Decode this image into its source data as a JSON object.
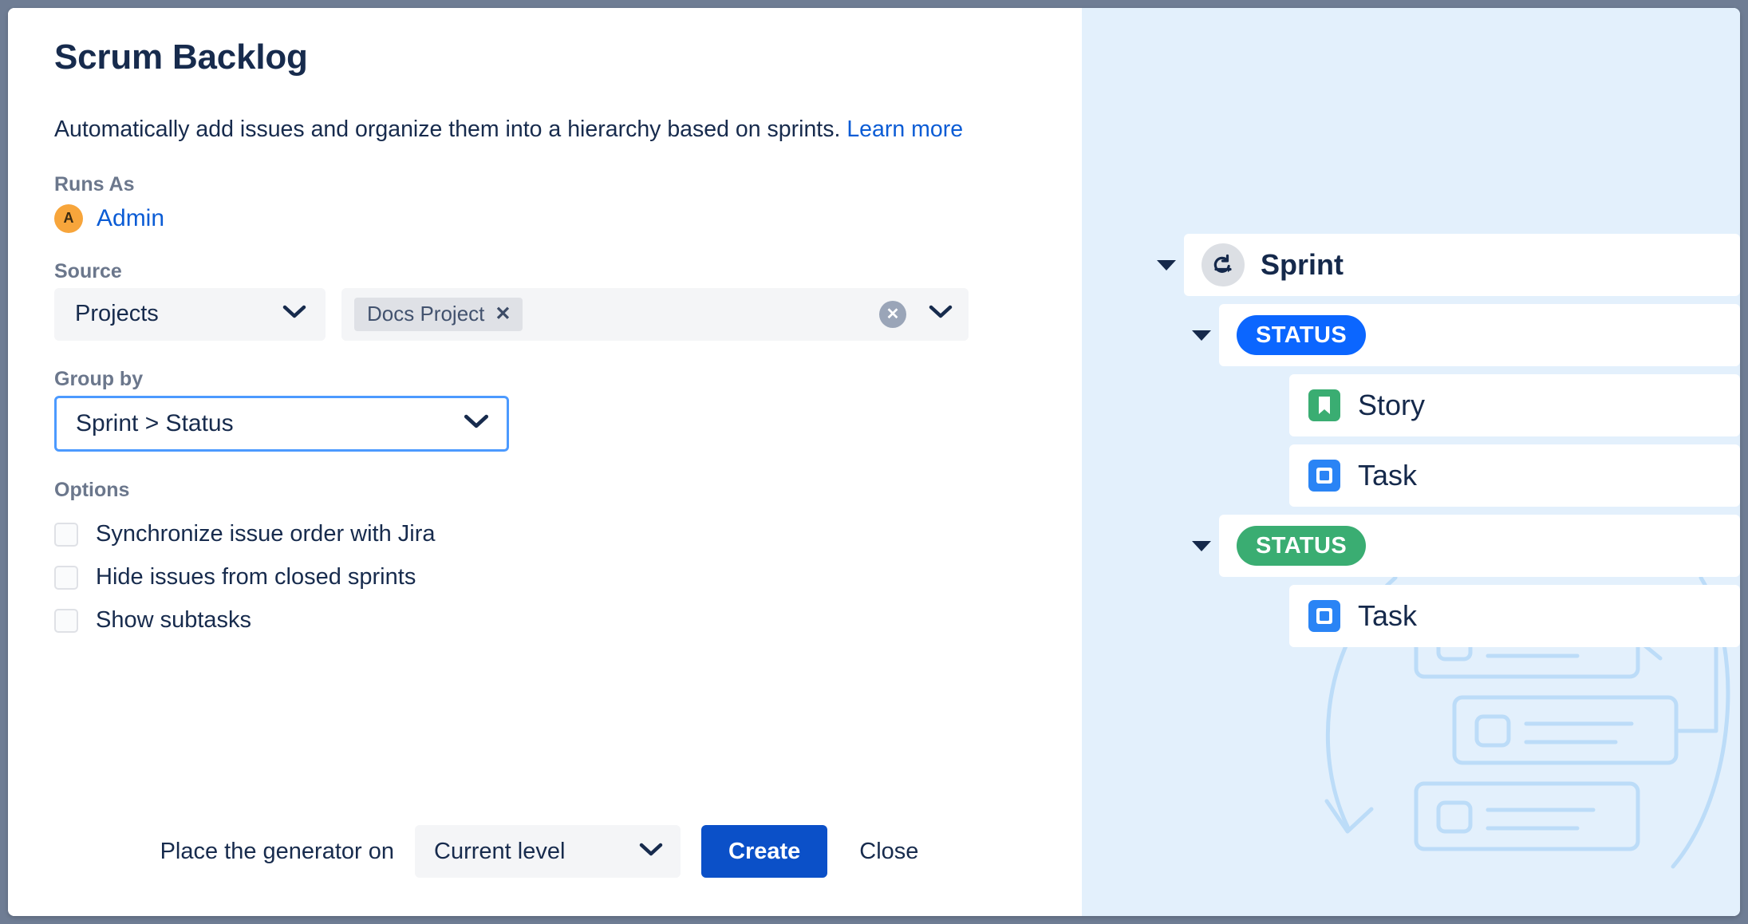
{
  "dialog": {
    "title": "Scrum Backlog",
    "description_before": "Automatically add issues and organize them into a hierarchy based on sprints.",
    "learn_more": "Learn more"
  },
  "runs_as": {
    "label": "Runs As",
    "avatar_initial": "A",
    "user": "Admin",
    "avatar_color": "#f7a53b"
  },
  "source": {
    "label": "Source",
    "type_select": "Projects",
    "chips": [
      {
        "label": "Docs Project",
        "remove": "✕"
      }
    ],
    "clear_icon": "✕"
  },
  "group_by": {
    "label": "Group by",
    "value": "Sprint > Status",
    "focus_color": "#4c9aff"
  },
  "options": {
    "label": "Options",
    "items": [
      {
        "label": "Synchronize issue order with Jira",
        "checked": false
      },
      {
        "label": "Hide issues from closed sprints",
        "checked": false
      },
      {
        "label": "Show subtasks",
        "checked": false
      }
    ]
  },
  "footer": {
    "place_label": "Place the generator on",
    "level_value": "Current level",
    "create_label": "Create",
    "close_label": "Close",
    "create_color": "#0b50c8"
  },
  "preview": {
    "background": "#e3f0fc",
    "tree": [
      {
        "label": "Sprint",
        "kind": "sprint",
        "indent": 0,
        "caret": true,
        "bold": true
      },
      {
        "label": "STATUS",
        "kind": "badge-blue",
        "indent": 1,
        "caret": true,
        "bold": false
      },
      {
        "label": "Story",
        "kind": "story",
        "indent": 2,
        "caret": false,
        "bold": false
      },
      {
        "label": "Task",
        "kind": "task",
        "indent": 2,
        "caret": false,
        "bold": false
      },
      {
        "label": "STATUS",
        "kind": "badge-green",
        "indent": 1,
        "caret": true,
        "bold": false
      },
      {
        "label": "Task",
        "kind": "task",
        "indent": 2,
        "caret": false,
        "bold": false
      }
    ],
    "colors": {
      "status_blue": "#0b66ff",
      "status_green": "#3aad72",
      "story_green": "#3aad72",
      "task_blue": "#2a84f5"
    }
  }
}
